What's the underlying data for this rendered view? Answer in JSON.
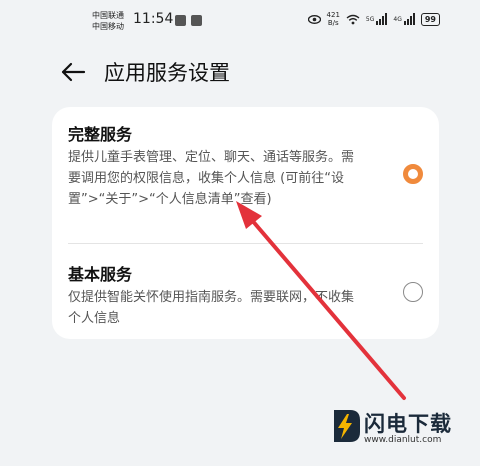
{
  "status_bar": {
    "carrier_1": "中国联通",
    "carrier_2": "中国移动",
    "time": "11:54",
    "net_speed_value": "421",
    "net_speed_unit": "B/s",
    "sim1_tag": "5G",
    "sim2_tag": "4G",
    "battery": "99",
    "icons": [
      "notification-app-icon",
      "eye-comfort-icon",
      "wifi-icon",
      "signal-icon",
      "battery-icon"
    ]
  },
  "header": {
    "title": "应用服务设置",
    "back_icon": "back-arrow-icon"
  },
  "options": [
    {
      "title": "完整服务",
      "desc": "提供儿童手表管理、定位、聊天、通话等服务。需要调用您的权限信息，收集个人信息 (可前往“设置”>“关于”>“个人信息清单”查看)",
      "selected": true
    },
    {
      "title": "基本服务",
      "desc": "仅提供智能关怀使用指南服务。需要联网，不收集个人信息",
      "selected": false
    }
  ],
  "colors": {
    "accent": "#f08a3c",
    "annotation_arrow": "#e3323b",
    "background": "#f1f3f5",
    "card": "#ffffff"
  },
  "watermark": {
    "name": "闪电下载",
    "url": "www.dianlut.com"
  }
}
